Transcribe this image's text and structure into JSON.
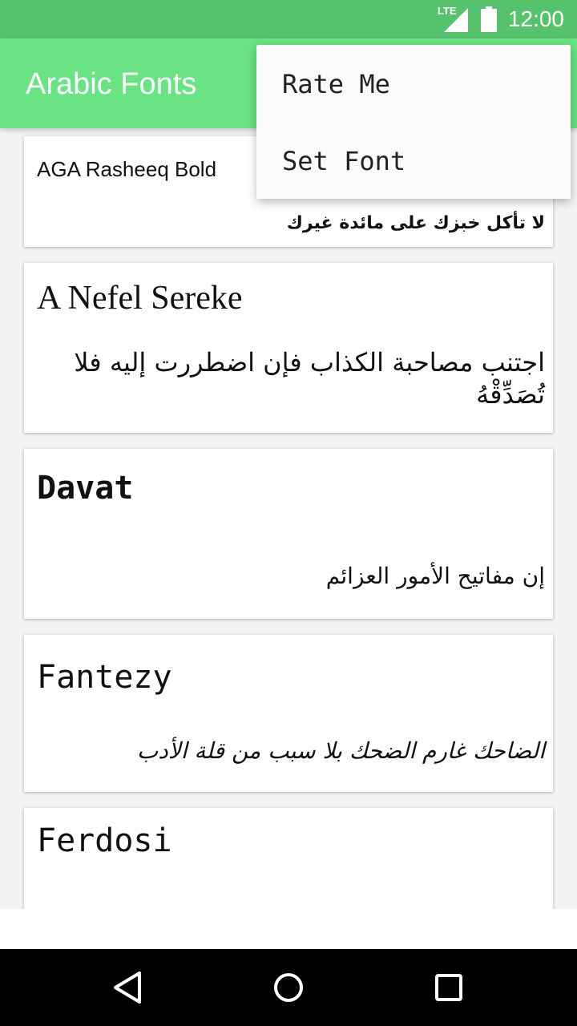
{
  "status_bar": {
    "network": "LTE",
    "time": "12:00"
  },
  "app_bar": {
    "title": "Arabic Fonts"
  },
  "menu": {
    "items": [
      {
        "label": "Rate Me"
      },
      {
        "label": "Set Font"
      }
    ]
  },
  "fonts": [
    {
      "name": "AGA Rasheeq Bold",
      "sample": "لا تأكل خبزك على مائدة غيرك"
    },
    {
      "name": "A Nefel Sereke",
      "sample": "اجتنب مصاحبة الكذاب فإن اضطررت إليه فلا تُصَدِّقْهُ"
    },
    {
      "name": "Davat",
      "sample": "إن مفاتيح الأمور العزائم"
    },
    {
      "name": "Fantezy",
      "sample": "الضاحك غارم الضحك بلا سبب من قلة الأدب"
    },
    {
      "name": "Ferdosi",
      "sample": ""
    }
  ],
  "nav_bar": {
    "back_icon": "back-triangle-icon",
    "home_icon": "home-circle-icon",
    "recents_icon": "recents-square-icon"
  }
}
